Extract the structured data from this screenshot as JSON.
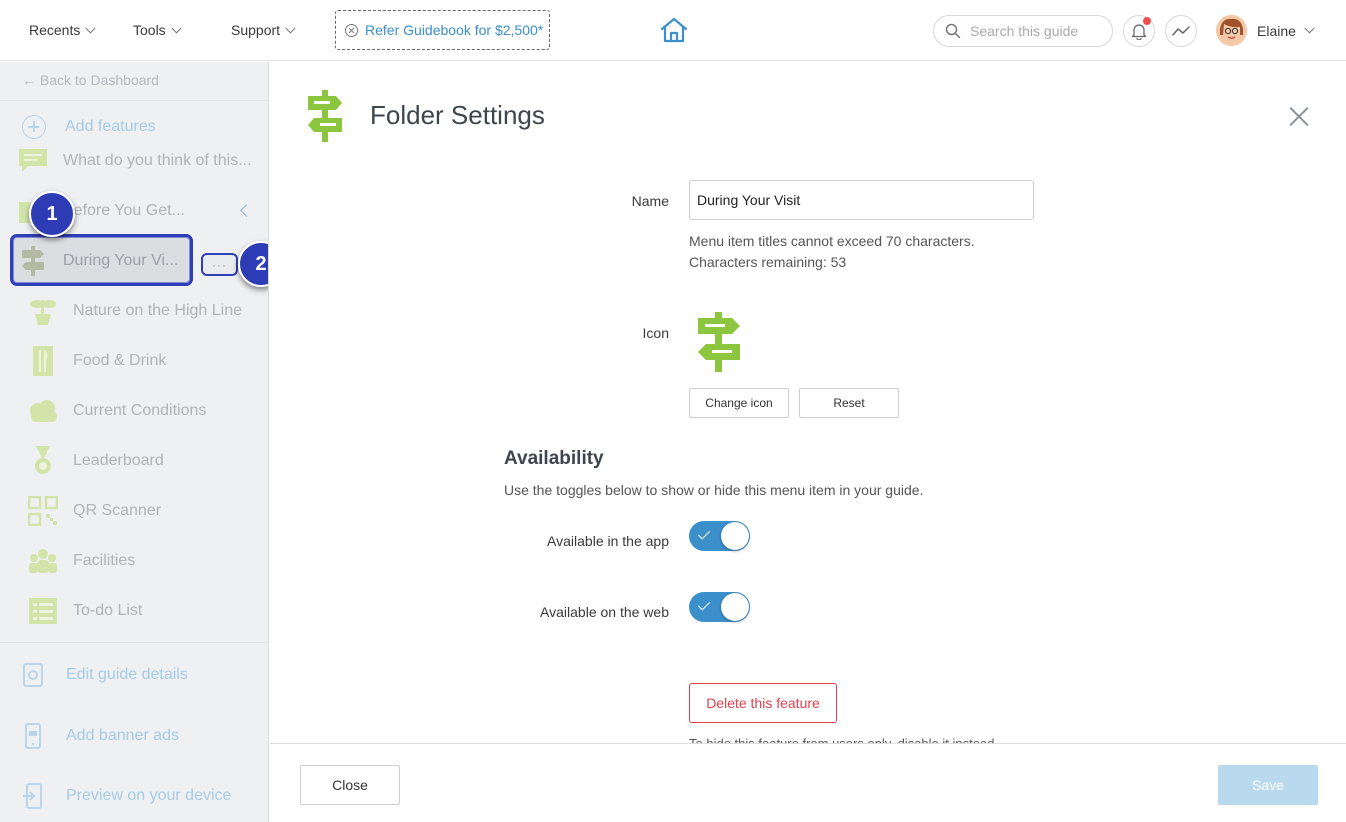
{
  "topbar": {
    "nav": [
      {
        "label": "Recents"
      },
      {
        "label": "Tools"
      },
      {
        "label": "Support"
      }
    ],
    "refer_label": "Refer Guidebook for $2,500*",
    "search_placeholder": "Search this guide",
    "user_name": "Elaine"
  },
  "sidebar": {
    "back_label": "← Back to Dashboard",
    "add_features_label": "Add features",
    "items": [
      {
        "label": "What do you think of this...",
        "icon": "speech-bubble-icon"
      },
      {
        "label": "Before You Get...",
        "icon": "folder-icon"
      },
      {
        "label": "During Your Vi...",
        "icon": "signpost-icon"
      },
      {
        "label": "Nature on the High Line",
        "icon": "plant-icon"
      },
      {
        "label": "Food & Drink",
        "icon": "utensils-icon"
      },
      {
        "label": "Current Conditions",
        "icon": "cloud-icon"
      },
      {
        "label": "Leaderboard",
        "icon": "medal-icon"
      },
      {
        "label": "QR Scanner",
        "icon": "qr-code-icon"
      },
      {
        "label": "Facilities",
        "icon": "people-icon"
      },
      {
        "label": "To-do List",
        "icon": "checklist-icon"
      }
    ],
    "bottom": [
      {
        "label": "Edit guide details",
        "icon": "settings-icon"
      },
      {
        "label": "Add banner ads",
        "icon": "phone-icon"
      },
      {
        "label": "Preview on your device",
        "icon": "device-preview-icon"
      }
    ],
    "dots_label": "···",
    "badges": [
      "1",
      "2"
    ]
  },
  "panel": {
    "title": "Folder Settings",
    "name_label": "Name",
    "name_value": "During Your Visit",
    "helper_line1": "Menu item titles cannot exceed 70 characters.",
    "helper_line2": "Characters remaining: 53",
    "icon_label": "Icon",
    "change_icon_label": "Change icon",
    "reset_label": "Reset",
    "availability_heading": "Availability",
    "availability_sub": "Use the toggles below to show or hide this menu item in your guide.",
    "app_label": "Available in the app",
    "web_label": "Available on the web",
    "app_enabled": true,
    "web_enabled": true,
    "delete_label": "Delete this feature",
    "delete_hint": "To hide this feature from users only, disable it instead."
  },
  "footer": {
    "close_label": "Close",
    "save_label": "Save"
  },
  "colors": {
    "accent": "#3b8fcb",
    "icon_green": "#8cc63f",
    "badge": "#2d3cb4",
    "danger": "#e0424c"
  }
}
